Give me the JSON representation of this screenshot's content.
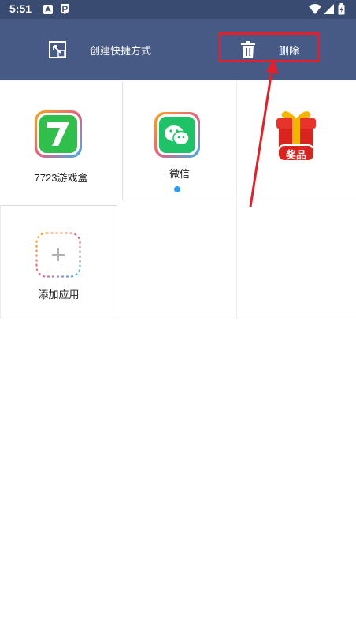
{
  "status_bar": {
    "time": "5:51"
  },
  "action_bar": {
    "create_shortcut_label": "创建快捷方式",
    "delete_label": "删除"
  },
  "apps": [
    {
      "label": "7723游戏盒"
    },
    {
      "label": "微信"
    },
    {
      "label": "",
      "badge": "奖品"
    }
  ],
  "add_app": {
    "label": "添加应用"
  },
  "colors": {
    "action_bar": "#475a85",
    "status_bar": "#3a4b72",
    "annotation": "#e0202a",
    "notification_dot": "#2f9cf0"
  }
}
